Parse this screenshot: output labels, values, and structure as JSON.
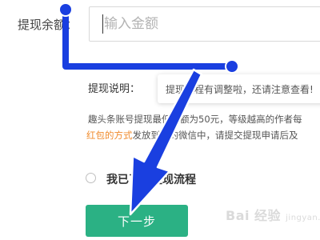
{
  "form": {
    "amount_label": "提现余额：",
    "amount_placeholder": "输入金额",
    "note_label": "提现说明：",
    "tooltip_text": "提现流程有调整啦，还请注意查看!",
    "description_line1": "趣头条账号提现最低限额为50元，等级越高的作者每",
    "description_line2_orange": "红包的方式",
    "description_line2_rest": "发放到您的微信中，请提交提现申请后及",
    "checkbox_label": "我已了解提现流程",
    "submit_label": "下一步"
  },
  "colors": {
    "button_green": "#2bb184",
    "highlight_orange": "#f08c2e",
    "annotation_blue": "#1a3fe0"
  },
  "watermark": {
    "main": "Bai 经验",
    "sub": "jingyan.baidu.com"
  }
}
